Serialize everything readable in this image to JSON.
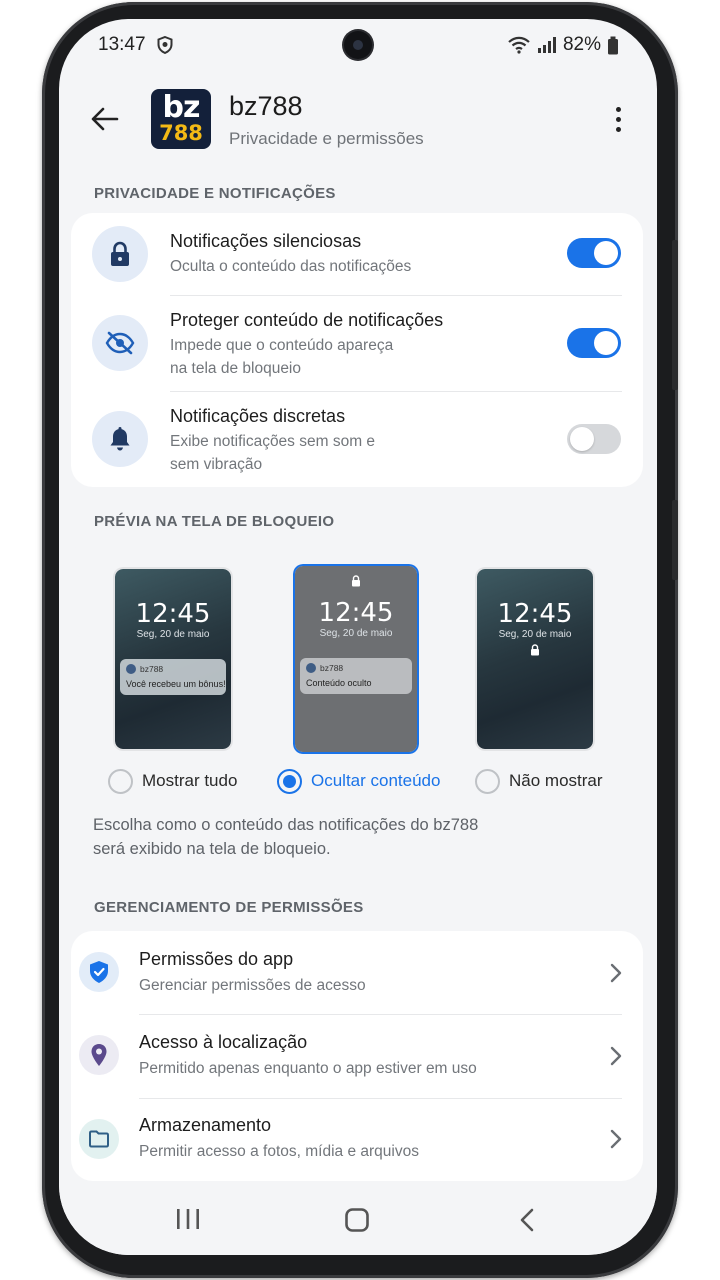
{
  "status_bar": {
    "time": "13:47",
    "battery": "82%"
  },
  "header": {
    "app_name": "bz788",
    "subtitle": "Privacidade e permissões",
    "logo_line1": "bz",
    "logo_line2": "788"
  },
  "privacy_section": {
    "label": "PRIVACIDADE E NOTIFICAÇÕES",
    "items": [
      {
        "title": "Notificações silenciosas",
        "sub1": "Oculta o conteúdo das notificações",
        "sub2": "",
        "icon": "lock-icon",
        "enabled": true
      },
      {
        "title": "Proteger conteúdo de notificações",
        "sub1": "Impede que o conteúdo apareça",
        "sub2": "na tela de bloqueio",
        "icon": "eye-off-icon",
        "enabled": true
      },
      {
        "title": "Notificações discretas",
        "sub1": "Exibe notificações sem som e",
        "sub2": "sem vibração",
        "icon": "bell-icon",
        "enabled": false
      }
    ]
  },
  "lockscreen_section": {
    "label": "PRÉVIA NA TELA DE BLOQUEIO",
    "preview_time": "12:45",
    "preview_date": "Seg, 20 de maio",
    "notif_app": "bz788",
    "notif_text_full": "Você recebeu um bônus!",
    "notif_text_hidden": "Conteúdo oculto",
    "options": [
      {
        "label": "Mostrar tudo",
        "selected": false
      },
      {
        "label": "Ocultar conteúdo",
        "selected": true
      },
      {
        "label": "Não mostrar",
        "selected": false
      }
    ],
    "description_line1": "Escolha como o conteúdo das notificações do bz788",
    "description_line2": "será exibido na tela de bloqueio."
  },
  "permissions_section": {
    "label": "GERENCIAMENTO DE PERMISSÕES",
    "items": [
      {
        "title": "Permissões do app",
        "sub": "Gerenciar permissões de acesso",
        "icon": "shield-icon"
      },
      {
        "title": "Acesso à localização",
        "sub": "Permitido apenas enquanto o app estiver em uso",
        "icon": "location-pin-icon"
      },
      {
        "title": "Armazenamento",
        "sub": "Permitir acesso a fotos, mídia e arquivos",
        "icon": "folder-icon"
      }
    ]
  },
  "colors": {
    "accent": "#1a73e8",
    "logo_bg": "#13203a",
    "logo_yellow": "#f3b915"
  }
}
